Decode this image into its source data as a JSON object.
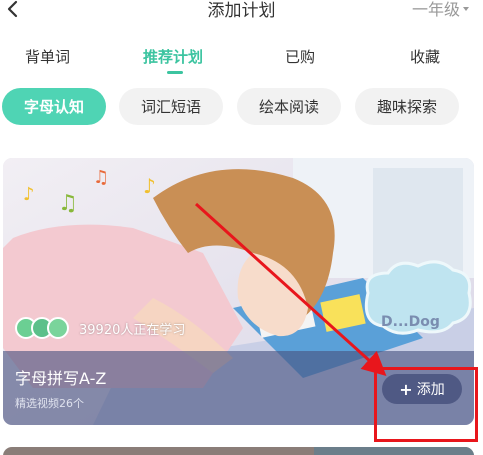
{
  "header": {
    "title": "添加计划",
    "grade": "一年级"
  },
  "tabs": [
    {
      "label": "背单词"
    },
    {
      "label": "推荐计划"
    },
    {
      "label": "已购"
    },
    {
      "label": "收藏"
    }
  ],
  "chips": [
    {
      "label": "字母认知"
    },
    {
      "label": "词汇短语"
    },
    {
      "label": "绘本阅读"
    },
    {
      "label": "趣味探索"
    }
  ],
  "card": {
    "learners": "39920人正在学习",
    "title": "字母拼写A-Z",
    "subtitle": "精选视频26个",
    "add_label": "添加",
    "image_text": "D...Dog"
  },
  "colors": {
    "accent": "#3cc4a0",
    "annotation": "#e8161c"
  }
}
